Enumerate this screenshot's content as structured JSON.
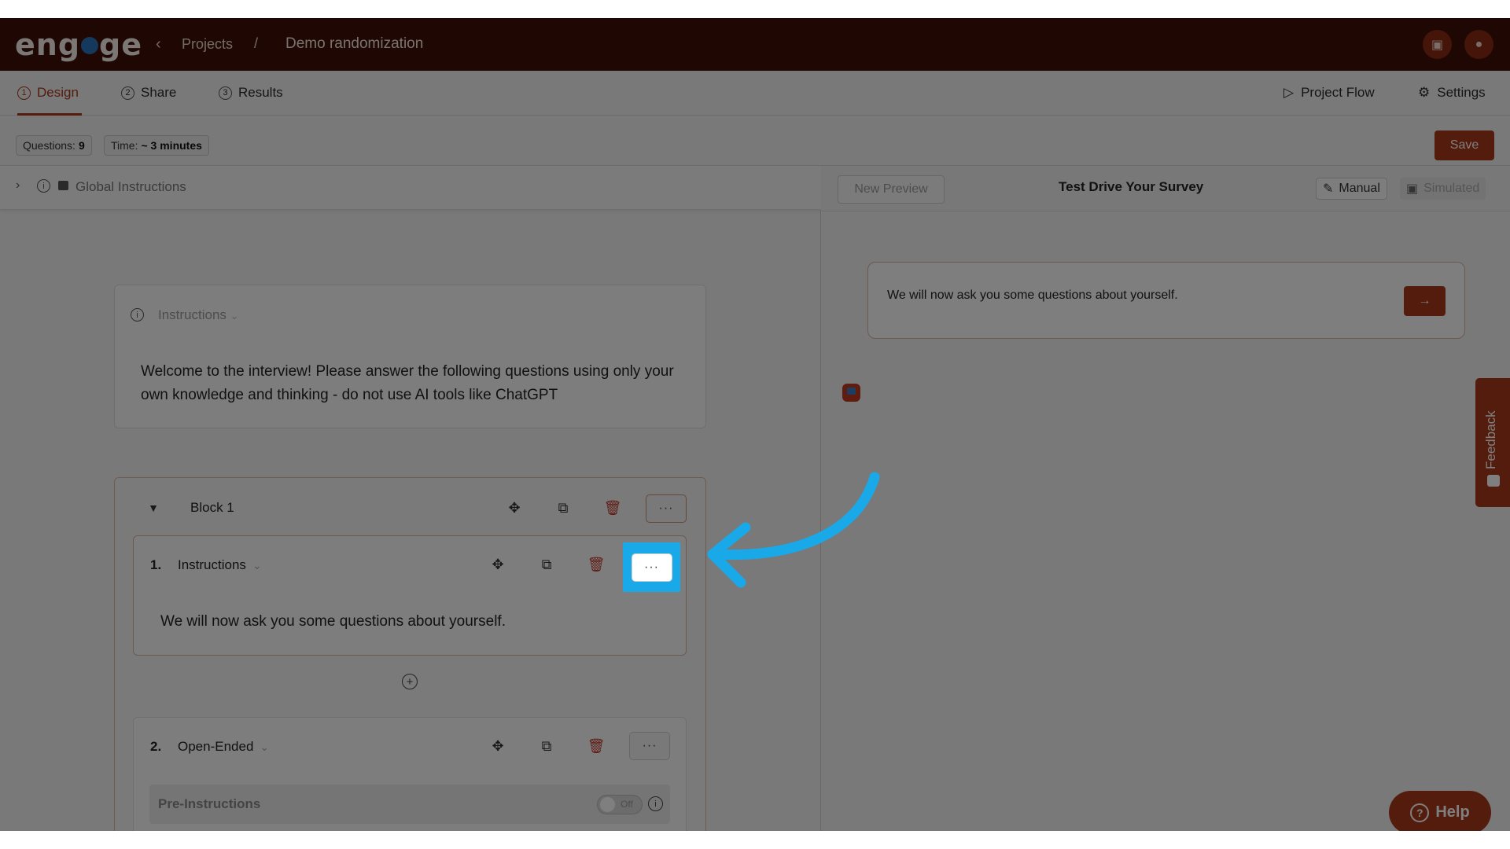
{
  "app": {
    "logo_text": "eng ge",
    "breadcrumb": {
      "back_icon": "chevron-left-icon",
      "projects": "Projects",
      "separator": "/",
      "current": "Demo randomization"
    },
    "top_icons": [
      "briefcase-icon",
      "user-icon"
    ]
  },
  "tabs": [
    {
      "num": "1",
      "label": "Design",
      "active": true
    },
    {
      "num": "2",
      "label": "Share",
      "active": false
    },
    {
      "num": "3",
      "label": "Results",
      "active": false
    }
  ],
  "right_links": {
    "project_flow": "Project Flow",
    "settings": "Settings"
  },
  "stats": {
    "questions_label": "Questions:",
    "questions_value": "9",
    "time_label": "Time:",
    "time_value": "~ 3 minutes"
  },
  "save_label": "Save",
  "global_instructions_label": "Global Instructions",
  "instructions_card": {
    "type_label": "Instructions",
    "text": "Welcome to the interview! Please answer the following questions using only your own knowledge and thinking - do not use AI tools like ChatGPT"
  },
  "block": {
    "title": "Block 1",
    "more_label": "···",
    "questions": [
      {
        "num": "1.",
        "type": "Instructions",
        "body": "We will now ask you some questions about yourself.",
        "more_label": "···"
      },
      {
        "num": "2.",
        "type": "Open-Ended",
        "more_label": "···",
        "pre_instructions_label": "Pre-Instructions",
        "toggle_label": "Off",
        "toggle_on": false
      }
    ]
  },
  "preview": {
    "new_preview_label": "New Preview",
    "title": "Test Drive Your Survey",
    "mode_manual": "Manual",
    "mode_simulated": "Simulated",
    "message": "We will now ask you some questions about yourself."
  },
  "feedback_label": "Feedback",
  "help_label": "Help",
  "colors": {
    "brand_dark": "#3e0f07",
    "accent": "#a8381a",
    "highlight": "#19a9e8"
  }
}
